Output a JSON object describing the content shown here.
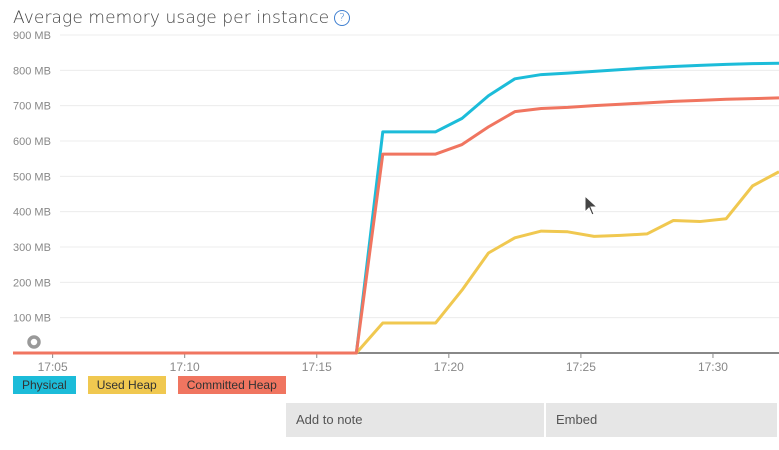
{
  "title": "Average memory usage per instance",
  "help_icon": "?",
  "buttons": {
    "add_to_note": "Add to note",
    "embed": "Embed"
  },
  "chart_data": {
    "type": "line",
    "title": "Average memory usage per instance",
    "xlabel": "",
    "ylabel": "",
    "x_unit": "minutes after 17:00",
    "x": [
      3.5,
      16.5,
      17.5,
      18.5,
      19.5,
      20.5,
      21.5,
      22.5,
      23.5,
      24.5,
      25.5,
      26.5,
      27.5,
      28.5,
      29.5,
      30.5,
      31.5,
      32.5
    ],
    "xlim": [
      3.5,
      32.5
    ],
    "ylim": [
      0,
      900
    ],
    "yticks": [
      100,
      200,
      300,
      400,
      500,
      600,
      700,
      800,
      900
    ],
    "ytick_labels": [
      "100 MB",
      "200 MB",
      "300 MB",
      "400 MB",
      "500 MB",
      "600 MB",
      "700 MB",
      "800 MB",
      "900 MB"
    ],
    "xticks": [
      5,
      10,
      15,
      20,
      25,
      30
    ],
    "xtick_labels": [
      "17:05",
      "17:10",
      "17:15",
      "17:20",
      "17:25",
      "17:30"
    ],
    "grid": true,
    "legend_placement": "bottom-left",
    "series": [
      {
        "name": "Physical",
        "color": "#1cbcd9",
        "values": [
          0,
          0,
          626,
          626,
          626,
          664,
          728,
          776,
          788,
          792,
          797,
          802,
          807,
          811,
          814,
          817,
          819,
          820
        ]
      },
      {
        "name": "Used Heap",
        "color": "#f0c850",
        "values": [
          0,
          0,
          85,
          85,
          85,
          178,
          283,
          326,
          345,
          343,
          330,
          333,
          337,
          375,
          372,
          380,
          473,
          513
        ]
      },
      {
        "name": "Committed Heap",
        "color": "#f07560",
        "values": [
          0,
          0,
          563,
          563,
          563,
          590,
          640,
          683,
          692,
          695,
          700,
          704,
          708,
          712,
          715,
          718,
          720,
          722
        ]
      }
    ]
  }
}
